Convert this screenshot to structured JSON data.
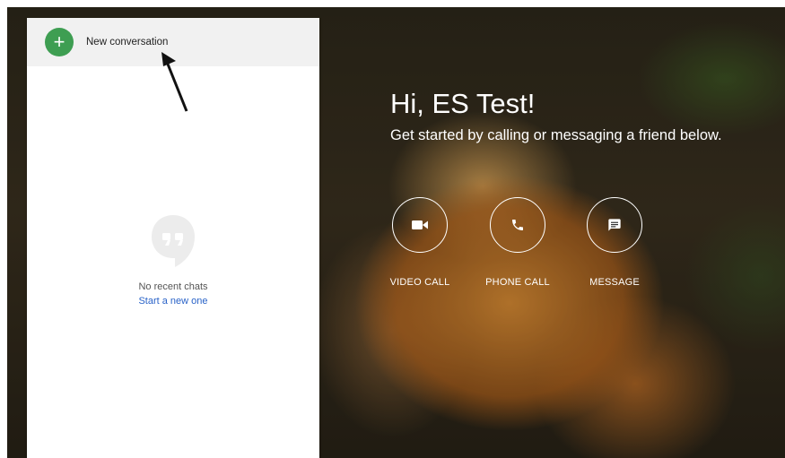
{
  "sidebar": {
    "new_conversation_label": "New conversation",
    "empty_state": {
      "message": "No recent chats",
      "link": "Start a new one"
    }
  },
  "main": {
    "greeting_title": "Hi, ES Test!",
    "greeting_subtitle": "Get started by calling or messaging a friend below.",
    "actions": [
      {
        "label": "VIDEO CALL",
        "icon": "video-camera-icon"
      },
      {
        "label": "PHONE CALL",
        "icon": "phone-icon"
      },
      {
        "label": "MESSAGE",
        "icon": "chat-message-icon"
      }
    ]
  },
  "colors": {
    "accent_green": "#3e9e52",
    "link_blue": "#2a63c8",
    "panel_header_bg": "#f1f1f1"
  }
}
